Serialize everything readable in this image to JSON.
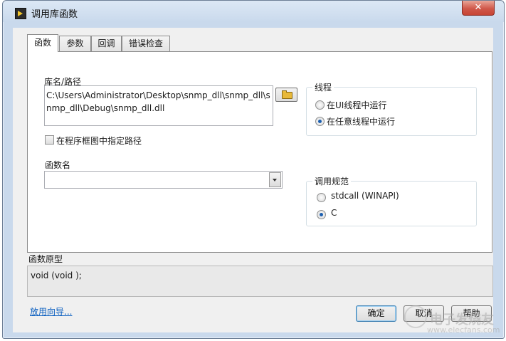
{
  "window": {
    "title": "调用库函数",
    "close_glyph": "✕"
  },
  "tabs": [
    {
      "label": "函数",
      "active": true
    },
    {
      "label": "参数",
      "active": false
    },
    {
      "label": "回调",
      "active": false
    },
    {
      "label": "错误检查",
      "active": false
    }
  ],
  "library": {
    "label": "库名/路径",
    "value": "C:\\Users\\Administrator\\Desktop\\snmp_dll\\snmp_dll\\snmp_dll\\Debug\\snmp_dll.dll",
    "specify_path_checkbox": {
      "label": "在程序框图中指定路径",
      "checked": false
    }
  },
  "function_name": {
    "label": "函数名",
    "value": ""
  },
  "thread": {
    "title": "线程",
    "options": [
      {
        "label": "在UI线程中运行",
        "checked": false
      },
      {
        "label": "在任意线程中运行",
        "checked": true
      }
    ]
  },
  "calling_convention": {
    "title": "调用规范",
    "options": [
      {
        "label": "stdcall (WINAPI)",
        "checked": false
      },
      {
        "label": "C",
        "checked": true
      }
    ]
  },
  "prototype": {
    "label": "函数原型",
    "value": "void  (void );"
  },
  "footer": {
    "help_link": "放用向导...",
    "ok_label": "确定",
    "cancel_label": "取消",
    "help_label": "帮助"
  },
  "watermark": {
    "brand": "电子发烧友",
    "url": "www.elecfans.com"
  },
  "colors": {
    "accent": "#1c5fb0",
    "link": "#0a5fc0",
    "close_button": "#d0584a"
  }
}
